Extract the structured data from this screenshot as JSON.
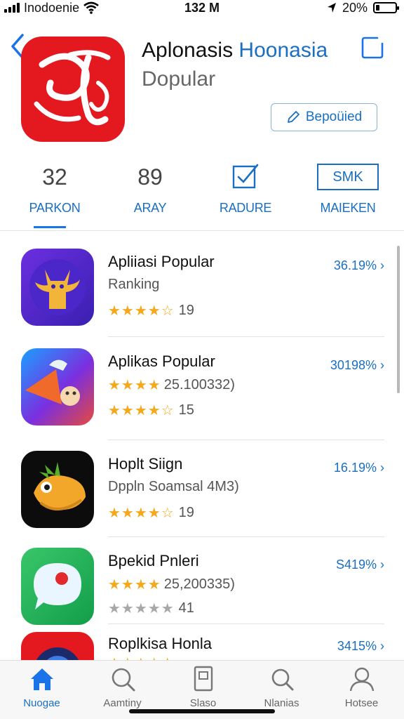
{
  "status_bar": {
    "carrier": "Inodoenie",
    "time": "132 M",
    "battery": "20%",
    "battery_level": 0.2
  },
  "app": {
    "title_part1": "Aplonasis",
    "title_part2": "Hoonasia",
    "subtitle": "Dopular",
    "action_button": "Bepoüied"
  },
  "stats": [
    {
      "value": "32",
      "label": "PARKON"
    },
    {
      "value": "89",
      "label": "ARAY"
    },
    {
      "value": "",
      "label": "RADURE",
      "icon": "checkbox-icon"
    },
    {
      "value": "SMK",
      "label": "MAIEKEN"
    }
  ],
  "app_list": [
    {
      "name": "Apliiasi Popular",
      "subtitle": "Ranking",
      "rating": 4.5,
      "rating_count": "19",
      "price": "36.19%",
      "icon": "purple-character-icon"
    },
    {
      "name": "Aplikas Popular",
      "subtitle": "25.100332)",
      "subtitle_rating": 4,
      "rating": 4.5,
      "rating_count": "15",
      "price": "30198%",
      "icon": "colorful-character-icon"
    },
    {
      "name": "Hoplt Siign",
      "subtitle": "Dppln Soamsal 4M3)",
      "rating": 4.5,
      "rating_count": "19",
      "price": "16.19%",
      "icon": "bird-icon"
    },
    {
      "name": "Bpekid Pnleri",
      "subtitle": "25,200335)",
      "subtitle_rating": 4,
      "rating": 0,
      "rating_count": "41",
      "price": "S419%",
      "icon": "chat-bubble-icon"
    },
    {
      "name": "Roplkisa Honla",
      "subtitle": "",
      "rating": 4.5,
      "rating_count": "",
      "price": "3415%",
      "icon": "camera-icon"
    }
  ],
  "tab_bar": [
    {
      "label": "Nuogae",
      "icon": "home-icon",
      "active": true
    },
    {
      "label": "Aamtiny",
      "icon": "search-icon",
      "active": false
    },
    {
      "label": "Slaso",
      "icon": "card-icon",
      "active": false
    },
    {
      "label": "Nlanias",
      "icon": "search-icon",
      "active": false
    },
    {
      "label": "Hotsee",
      "icon": "person-icon",
      "active": false
    }
  ],
  "colors": {
    "accent": "#1a73e8",
    "accent_text": "#1a6fc2",
    "star_gold": "#f4a91c",
    "app_icon_red": "#e4181f"
  }
}
